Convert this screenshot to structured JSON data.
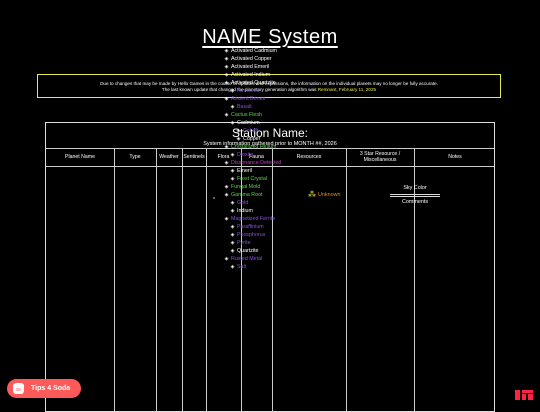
{
  "page": {
    "title": "NAME System",
    "notice_line1": "Due to changes that may be made by Hello Games in the course of updates and expansions, the information on the individual planets may no longer be fully accurate.",
    "notice_line2_prefix": "The last known update that changed the planetary generation algorithm was",
    "notice_update": "Remnant, February 11, 2025"
  },
  "station": {
    "name": "Station Name:",
    "info": "System information gathered prior to MONTH ##, 2026"
  },
  "columns": [
    "Planet Name",
    "Type",
    "Weather",
    "Sentinels",
    "Flora",
    "Fauna",
    "Resources",
    "3 Star Resource / Miscellaneous",
    "Notes"
  ],
  "fauna_value": "*",
  "resources": [
    {
      "label": "Activated Cadmium",
      "color": "#ffffff",
      "indent": 0
    },
    {
      "label": "Activated Copper",
      "color": "#ffffff",
      "indent": 0
    },
    {
      "label": "Activated Emeril",
      "color": "#ffffff",
      "indent": 0
    },
    {
      "label": "Activated Indium",
      "color": "#ffffff",
      "indent": 0
    },
    {
      "label": "Activated Quartzite",
      "color": "#ffffff",
      "indent": 0
    },
    {
      "label": "Ammonia",
      "color": "#8a4fe0",
      "indent": 1
    },
    {
      "label": "Ancient Bones",
      "color": "#8a4fe0",
      "indent": 0
    },
    {
      "label": "Basalt",
      "color": "#8a4fe0",
      "indent": 1
    },
    {
      "label": "Cactus Flesh",
      "color": "#56d64a",
      "indent": 0
    },
    {
      "label": "Cadmium",
      "color": "#ffffff",
      "indent": 1
    },
    {
      "label": "Cobalt",
      "color": "#8a4fe0",
      "indent": 2
    },
    {
      "label": "Copper",
      "color": "#ffffff",
      "indent": 2
    },
    {
      "label": "Crystallized Helium",
      "color": "#56d64a",
      "indent": 0
    },
    {
      "label": "Dioxite",
      "color": "#8a4fe0",
      "indent": 1
    },
    {
      "label": "Dissonance Detected",
      "color": "#c43cc4",
      "indent": 0
    },
    {
      "label": "Emeril",
      "color": "#ffffff",
      "indent": 1
    },
    {
      "label": "Frost Crystal",
      "color": "#56d64a",
      "indent": 1
    },
    {
      "label": "Fungal Mold",
      "color": "#56d64a",
      "indent": 0
    },
    {
      "label": "Gamma Root",
      "color": "#56d64a",
      "indent": 0
    },
    {
      "label": "Gold",
      "color": "#8a4fe0",
      "indent": 1
    },
    {
      "label": "Indium",
      "color": "#ffffff",
      "indent": 1
    },
    {
      "label": "Magnetized Ferrite",
      "color": "#8a4fe0",
      "indent": 0
    },
    {
      "label": "Paraffinium",
      "color": "#8a4fe0",
      "indent": 1
    },
    {
      "label": "Phosphorus",
      "color": "#8a4fe0",
      "indent": 1
    },
    {
      "label": "Pyrite",
      "color": "#8a4fe0",
      "indent": 1
    },
    {
      "label": "Quartzite",
      "color": "#ffffff",
      "indent": 1
    },
    {
      "label": "Rusted Metal",
      "color": "#8a4fe0",
      "indent": 0
    },
    {
      "label": "Salt",
      "color": "#8a4fe0",
      "indent": 1
    }
  ],
  "misc": {
    "unknown_label": "Unknown"
  },
  "notes": {
    "sky_color": "Sky Color",
    "comments": "Comments"
  },
  "badge": {
    "label": "Tips 4 Soda"
  },
  "colors": {
    "accent_yellow": "#e8e84a",
    "badge_red": "#ff5a5a",
    "unknown_orange": "#e38b1b"
  }
}
